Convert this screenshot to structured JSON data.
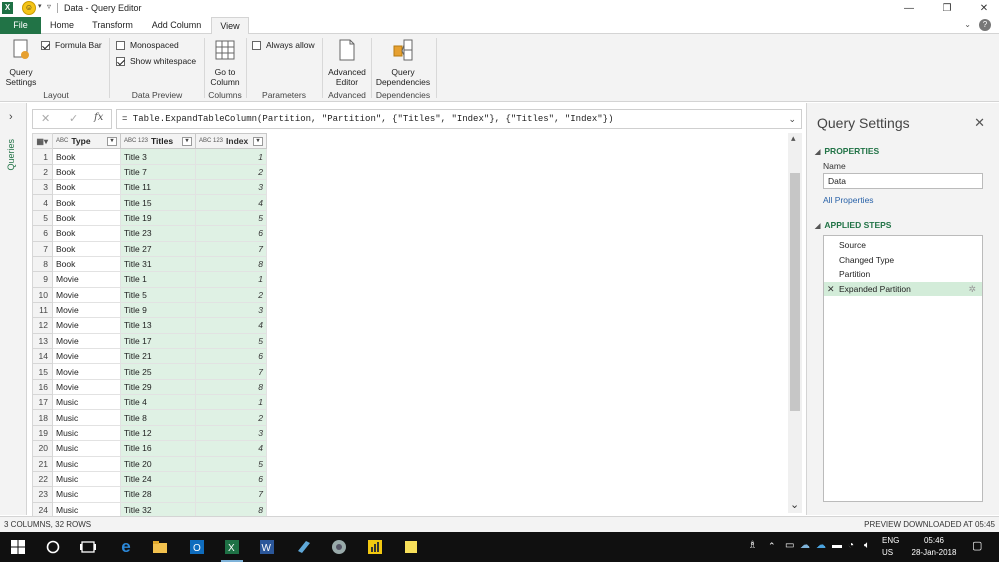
{
  "window": {
    "app_icon": "excel-icon",
    "title": "Data - Query Editor",
    "controls": [
      "minimize",
      "restore",
      "close"
    ]
  },
  "ribbon_tabs": [
    "File",
    "Home",
    "Transform",
    "Add Column",
    "View"
  ],
  "active_tab": "View",
  "ribbon": {
    "layout": {
      "query_settings": "Query\nSettings",
      "formula_bar": "Formula Bar",
      "label": "Layout"
    },
    "data_preview": {
      "monospaced": "Monospaced",
      "show_whitespace": "Show whitespace",
      "label": "Data Preview"
    },
    "columns": {
      "go_to_column": "Go to\nColumn",
      "label": "Columns"
    },
    "parameters": {
      "always_allow": "Always allow",
      "label": "Parameters"
    },
    "advanced": {
      "advanced_editor": "Advanced\nEditor",
      "label": "Advanced"
    },
    "dependencies": {
      "query_dependencies": "Query\nDependencies",
      "label": "Dependencies"
    }
  },
  "checkboxes": {
    "formula_bar": true,
    "monospaced": false,
    "show_whitespace": true,
    "always_allow": false
  },
  "queries_pane": {
    "label": "Queries"
  },
  "formula_bar": {
    "fx": "fx",
    "formula": "= Table.ExpandTableColumn(Partition, \"Partition\", {\"Titles\", \"Index\"}, {\"Titles\", \"Index\"})"
  },
  "grid": {
    "columns": [
      {
        "name": "Type",
        "type_icon": "ABC"
      },
      {
        "name": "Titles",
        "type_icon": "ABC 123"
      },
      {
        "name": "Index",
        "type_icon": "ABC 123"
      }
    ],
    "rows": [
      [
        "1",
        "Book",
        "Title 3",
        "1"
      ],
      [
        "2",
        "Book",
        "Title 7",
        "2"
      ],
      [
        "3",
        "Book",
        "Title 11",
        "3"
      ],
      [
        "4",
        "Book",
        "Title 15",
        "4"
      ],
      [
        "5",
        "Book",
        "Title 19",
        "5"
      ],
      [
        "6",
        "Book",
        "Title 23",
        "6"
      ],
      [
        "7",
        "Book",
        "Title 27",
        "7"
      ],
      [
        "8",
        "Book",
        "Title 31",
        "8"
      ],
      [
        "9",
        "Movie",
        "Title 1",
        "1"
      ],
      [
        "10",
        "Movie",
        "Title 5",
        "2"
      ],
      [
        "11",
        "Movie",
        "Title 9",
        "3"
      ],
      [
        "12",
        "Movie",
        "Title 13",
        "4"
      ],
      [
        "13",
        "Movie",
        "Title 17",
        "5"
      ],
      [
        "14",
        "Movie",
        "Title 21",
        "6"
      ],
      [
        "15",
        "Movie",
        "Title 25",
        "7"
      ],
      [
        "16",
        "Movie",
        "Title 29",
        "8"
      ],
      [
        "17",
        "Music",
        "Title 4",
        "1"
      ],
      [
        "18",
        "Music",
        "Title 8",
        "2"
      ],
      [
        "19",
        "Music",
        "Title 12",
        "3"
      ],
      [
        "20",
        "Music",
        "Title 16",
        "4"
      ],
      [
        "21",
        "Music",
        "Title 20",
        "5"
      ],
      [
        "22",
        "Music",
        "Title 24",
        "6"
      ],
      [
        "23",
        "Music",
        "Title 28",
        "7"
      ],
      [
        "24",
        "Music",
        "Title 32",
        "8"
      ]
    ]
  },
  "query_settings": {
    "title": "Query Settings",
    "properties_header": "PROPERTIES",
    "name_label": "Name",
    "name_value": "Data",
    "all_properties": "All Properties",
    "applied_steps_header": "APPLIED STEPS",
    "steps": [
      "Source",
      "Changed Type",
      "Partition",
      "Expanded Partition"
    ],
    "active_step": "Expanded Partition"
  },
  "status": {
    "left": "3 COLUMNS, 32 ROWS",
    "right": "PREVIEW DOWNLOADED AT 05:45"
  },
  "taskbar": {
    "lang_top": "ENG",
    "lang_bottom": "US",
    "time": "05:46",
    "date": "28-Jan-2018"
  },
  "colors": {
    "accent": "#217346",
    "column_highlight": "#dff1e4",
    "active_step": "#d3ecd9"
  }
}
